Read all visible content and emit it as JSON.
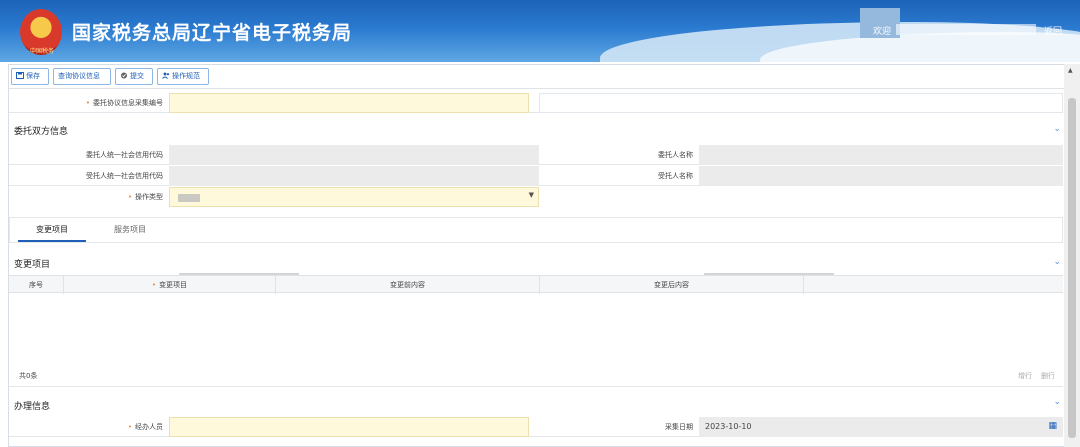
{
  "header": {
    "site_title": "国家税务总局辽宁省电子税务局",
    "emblem_text": "中国税务",
    "welcome": "欢迎",
    "return_label": "返回"
  },
  "toolbar": {
    "save_label": "保存",
    "query_agreement_label": "查询协议信息",
    "submit_label": "提交",
    "guide_label": "操作规范"
  },
  "agreement": {
    "collection_no_label": "委托协议信息采集编号"
  },
  "parties": {
    "section_title": "委托双方信息",
    "principal_code_label": "委托人统一社会信用代码",
    "principal_name_label": "委托人名称",
    "agent_code_label": "受托人统一社会信用代码",
    "agent_name_label": "受托人名称",
    "operation_type_label": "操作类型"
  },
  "tabs": [
    {
      "label": "变更项目",
      "active": true
    },
    {
      "label": "服务项目",
      "active": false
    }
  ],
  "changes": {
    "section_title": "变更项目",
    "columns": [
      "序号",
      "变更项目",
      "变更前内容",
      "变更后内容"
    ],
    "count_text": "共0条",
    "add_row_label": "增行",
    "delete_row_label": "删行"
  },
  "handling": {
    "section_title": "办理信息",
    "handler_label": "经办人员",
    "date_label": "采集日期",
    "date_value": "2023-10-10"
  },
  "colors": {
    "accent": "#1f5fb8",
    "required": "#f08c3c",
    "input_required_bg": "#fff9dc",
    "readonly_bg": "#ebebeb"
  }
}
